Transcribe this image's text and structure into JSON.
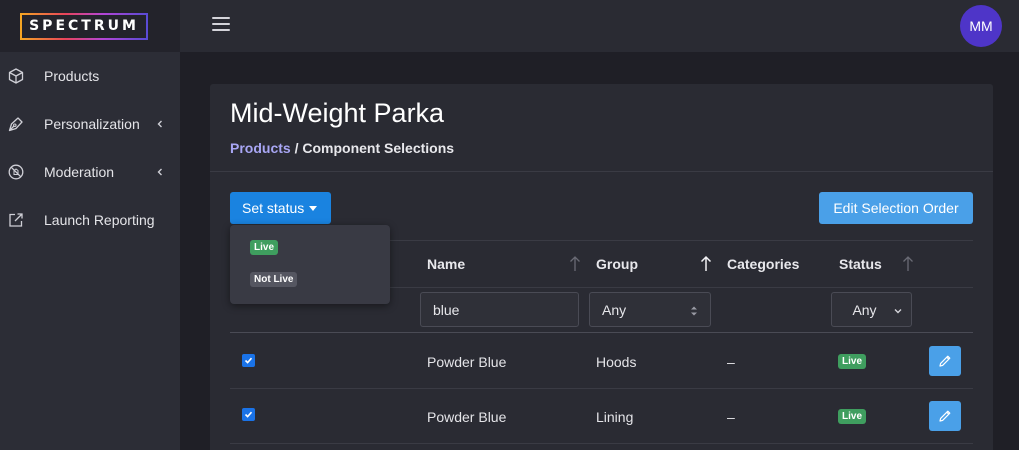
{
  "app": {
    "logo_text": "SPECTRUM"
  },
  "sidebar": {
    "items": [
      {
        "label": "Products",
        "icon": "cube-icon",
        "has_chevron": false
      },
      {
        "label": "Personalization",
        "icon": "pen-nib-icon",
        "has_chevron": true
      },
      {
        "label": "Moderation",
        "icon": "ban-icon",
        "has_chevron": true
      },
      {
        "label": "Launch Reporting",
        "icon": "external-link-icon",
        "has_chevron": false
      }
    ]
  },
  "header": {
    "menu_icon": "hamburger-icon",
    "avatar_initials": "MM"
  },
  "page": {
    "title": "Mid-Weight Parka",
    "breadcrumb": {
      "link": "Products",
      "separator": " / ",
      "current": "Component Selections"
    }
  },
  "toolbar": {
    "set_status_label": "Set status",
    "edit_order_label": "Edit Selection Order"
  },
  "status_menu": {
    "options": [
      "Live",
      "Not Live"
    ]
  },
  "table": {
    "columns": [
      "Name",
      "Group",
      "Categories",
      "Status"
    ],
    "filters": {
      "name_value": "blue",
      "group_value": "Any",
      "status_value": "Any"
    },
    "rows": [
      {
        "checked": true,
        "name": "Powder Blue",
        "group": "Hoods",
        "categories": "–",
        "status": "Live"
      },
      {
        "checked": true,
        "name": "Powder Blue",
        "group": "Lining",
        "categories": "–",
        "status": "Live"
      }
    ]
  },
  "colors": {
    "primary": "#1a83e0",
    "secondary_button": "#4aa0e8",
    "live_badge": "#3f9e5f",
    "not_live_badge": "#555661",
    "avatar": "#4e35c8",
    "link": "#a8a6f4"
  }
}
